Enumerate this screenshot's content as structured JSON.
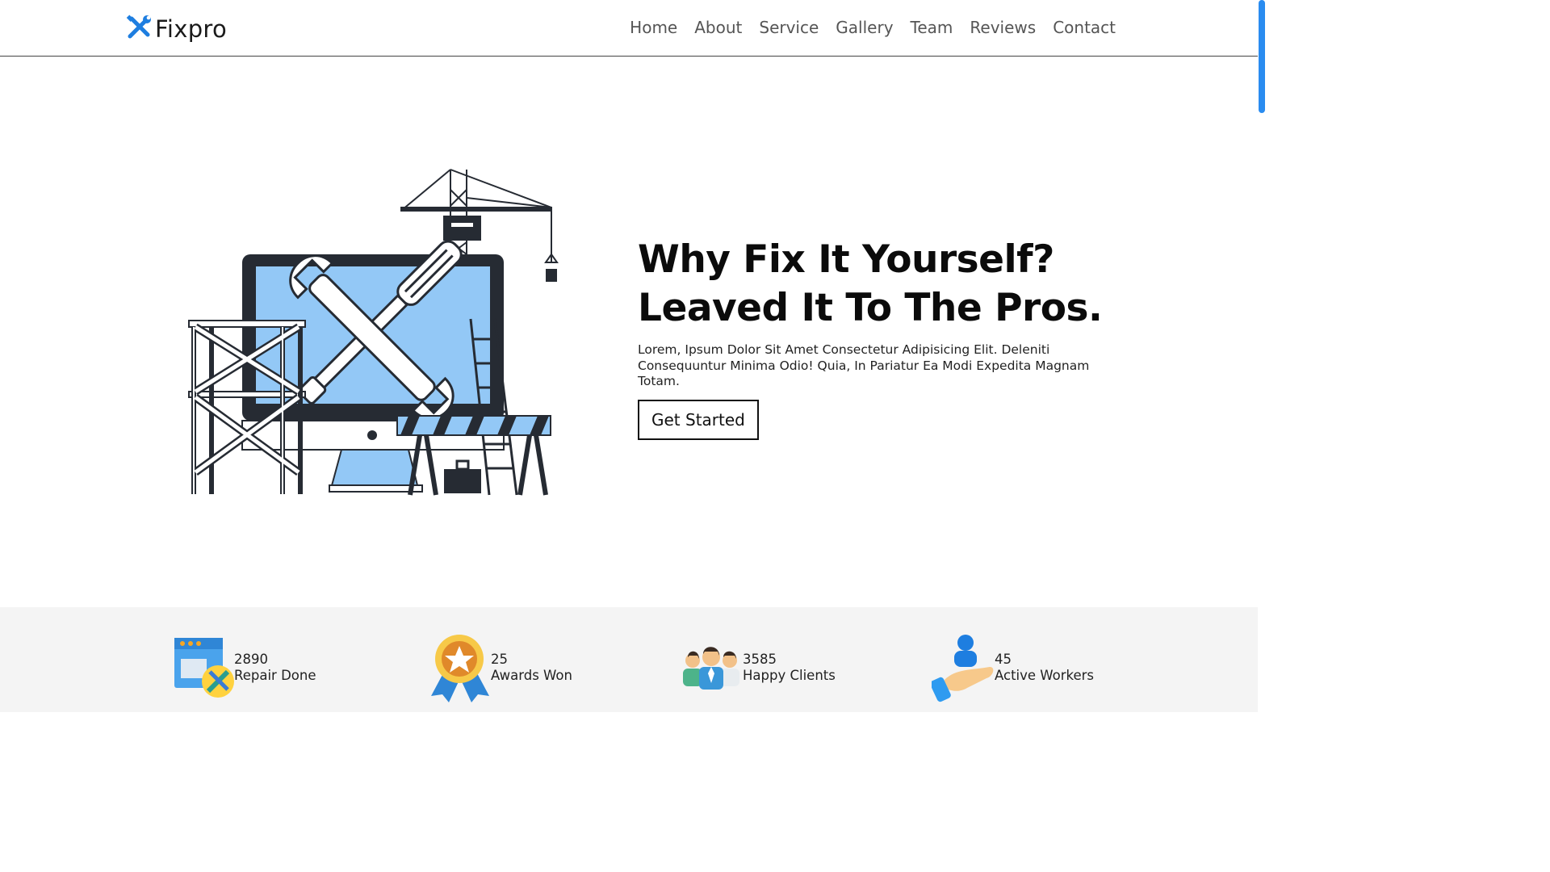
{
  "header": {
    "logo_text": "Fixpro",
    "logo_icon": "wrench-screwdriver-icon",
    "accent_color": "#1e7ee0",
    "nav": [
      {
        "label": "Home"
      },
      {
        "label": "About"
      },
      {
        "label": "Service"
      },
      {
        "label": "Gallery"
      },
      {
        "label": "Team"
      },
      {
        "label": "Reviews"
      },
      {
        "label": "Contact"
      }
    ]
  },
  "hero": {
    "headline_line1": "Why Fix It Yourself?",
    "headline_line2": "Leaved It To The Pros.",
    "description": "Lorem, Ipsum Dolor Sit Amet Consectetur Adipisicing Elit. Deleniti Consequuntur Minima Odio! Quia, In Pariatur Ea Modi Expedita Magnam Totam.",
    "cta_label": "Get Started",
    "illustration": "repair-construction-illustration"
  },
  "stats": [
    {
      "value": "2890",
      "label": "Repair Done",
      "icon": "repair-browser-icon"
    },
    {
      "value": "25",
      "label": "Awards Won",
      "icon": "award-medal-icon"
    },
    {
      "value": "3585",
      "label": "Happy Clients",
      "icon": "clients-group-icon"
    },
    {
      "value": "45",
      "label": "Active Workers",
      "icon": "worker-hand-icon"
    }
  ]
}
